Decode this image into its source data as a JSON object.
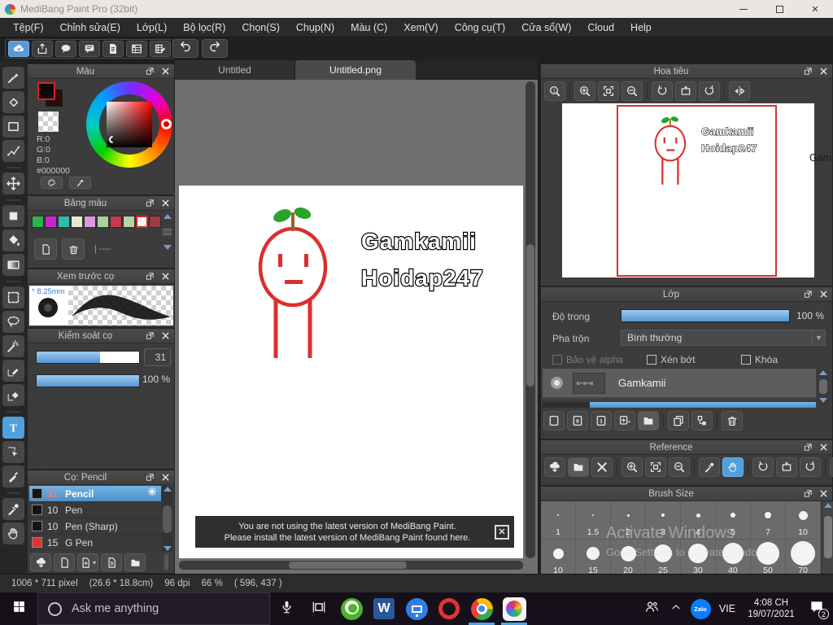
{
  "window": {
    "title": "MediBang Paint Pro (32bit)"
  },
  "menu": {
    "items": [
      "Tệp(F)",
      "Chỉnh sửa(E)",
      "Lớp(L)",
      "Bộ lọc(R)",
      "Chọn(S)",
      "Chụp(N)",
      "Màu (C)",
      "Xem(V)",
      "Công cụ(T)",
      "Cửa sổ(W)",
      "Cloud",
      "Help"
    ]
  },
  "top_toolbar": {
    "group_icons": [
      "cloud-check",
      "publish",
      "speech-bubble",
      "comment",
      "document",
      "grid-clock",
      "grid-edit"
    ]
  },
  "tool_strip": {
    "tools": [
      "brush",
      "eraser",
      "shape-rect",
      "control-points",
      "|",
      "move",
      "|",
      "fill-rect",
      "bucket",
      "gradient",
      "|",
      "select-marquee",
      "select-lasso",
      "magic-wand",
      "select-pen",
      "select-eraser",
      "|",
      "text*",
      "object-select",
      "pen-stick",
      "|",
      "eyedropper",
      "hand"
    ]
  },
  "tabs": [
    {
      "label": "Untitled",
      "active": false
    },
    {
      "label": "Untitled.png",
      "active": true
    }
  ],
  "color_panel": {
    "title": "Màu",
    "r_label": "R:0",
    "g_label": "G:0",
    "b_label": "B:0",
    "hex_label": "#000000",
    "button_icons": [
      "palette",
      "eyedropper"
    ]
  },
  "palette_panel": {
    "title": "Bảng màu",
    "colors": [
      "#2db34d",
      "#cc22cc",
      "#2fbcab",
      "#e9e9d0",
      "#dd97dd",
      "#accf9b",
      "#c63b50",
      "#b5d6a3",
      "#ffffff",
      "#a03a48"
    ],
    "selected_index": 8,
    "footer_text": "----",
    "button_icons": [
      "new-doc",
      "trash"
    ]
  },
  "preview_panel": {
    "title": "Xem trước cọ",
    "size_label": "* 8.25mm"
  },
  "control_panel": {
    "title": "Kiểm soát cọ",
    "size_value": "31",
    "opacity_value": "100 %",
    "size_fraction": 0.62,
    "opacity_fraction": 1
  },
  "brush_panel": {
    "title": "Cọ: Pencil",
    "brushes": [
      {
        "size": "31",
        "name": "Pencil",
        "swatch": "#141414",
        "selected": true
      },
      {
        "size": "10",
        "name": "Pen",
        "swatch": "#141414",
        "selected": false
      },
      {
        "size": "10",
        "name": "Pen (Sharp)",
        "swatch": "#141414",
        "selected": false
      },
      {
        "size": "15",
        "name": "G Pen",
        "swatch": "#e23232",
        "selected": false
      }
    ],
    "footer_icons": [
      "cloud-down",
      "new-doc",
      "doc-add",
      "doc-s",
      "folder"
    ]
  },
  "canvas": {
    "text_line1": "Gamkamii",
    "text_line2": "Hoidap247"
  },
  "notification": {
    "line1": "You are not using the latest version of MediBang Paint.",
    "line2": "Please install the latest version of MediBang Paint found here."
  },
  "navigator": {
    "title": "Hoa tiêu",
    "toolbar_icons": [
      "zoom-actual",
      "|",
      "zoom-in",
      "zoom-fit",
      "zoom-out",
      "|",
      "rotate-ccw",
      "rotate-reset",
      "rotate-cw",
      "|",
      "flip-h"
    ],
    "side_text": "Gam"
  },
  "layer_panel": {
    "title": "Lớp",
    "opacity_label": "Độ trong",
    "opacity_value": "100 %",
    "blend_label": "Pha trộn",
    "blend_value": "Bình thường",
    "check_alpha": "Bảo vệ alpha",
    "check_clip": "Xén bớt",
    "check_lock": "Khóa",
    "layer_name": "Gamkamii",
    "footer_icons": [
      "new-layer",
      "layer-8bit",
      "layer-1bit",
      "add-layer-menu",
      "folder",
      "|",
      "duplicate",
      "merge-down",
      "|",
      "trash"
    ]
  },
  "reference_panel": {
    "title": "Reference",
    "toolbar_icons": [
      "cloud-down",
      "folder",
      "close-x",
      "|",
      "zoom-in",
      "zoom-fit",
      "zoom-out",
      "|",
      "eyedropper",
      "hand*",
      "|",
      "rotate-ccw",
      "rotate-reset",
      "rotate-cw",
      "|",
      "flip-h"
    ]
  },
  "brush_size_panel": {
    "title": "Brush Size",
    "row1": [
      {
        "label": "1",
        "d": 2
      },
      {
        "label": "1.5",
        "d": 2.5
      },
      {
        "label": "2",
        "d": 3
      },
      {
        "label": "3",
        "d": 4
      },
      {
        "label": "4",
        "d": 5
      },
      {
        "label": "5",
        "d": 6
      },
      {
        "label": "7",
        "d": 8
      },
      {
        "label": "10",
        "d": 11
      }
    ],
    "row2": [
      {
        "label": "10",
        "d": 13
      },
      {
        "label": "15",
        "d": 16
      },
      {
        "label": "20",
        "d": 19
      },
      {
        "label": "25",
        "d": 22
      },
      {
        "label": "30",
        "d": 24
      },
      {
        "label": "40",
        "d": 26
      },
      {
        "label": "50",
        "d": 28
      },
      {
        "label": "70",
        "d": 30
      }
    ]
  },
  "watermark": {
    "line1": "Activate Windows",
    "line2": "Go to Settings to activate Windows."
  },
  "status_bar": {
    "size": "1006 * 711 pixel",
    "dimensions": "(26.6 * 18.8cm)",
    "dpi": "96 dpi",
    "zoom": "66 %",
    "coords": "( 596, 437 )"
  },
  "taskbar": {
    "search_placeholder": "Ask me anything",
    "apps": [
      {
        "name": "coccoc",
        "open": false
      },
      {
        "name": "word",
        "open": false
      },
      {
        "name": "remote-desktop",
        "open": false
      },
      {
        "name": "opera",
        "open": false
      },
      {
        "name": "chrome",
        "open": true
      },
      {
        "name": "medibang",
        "open": true
      }
    ],
    "language": "VIE",
    "time": "4:08 CH",
    "date": "19/07/2021",
    "badge": "2",
    "zalo_label": "Zalo"
  }
}
